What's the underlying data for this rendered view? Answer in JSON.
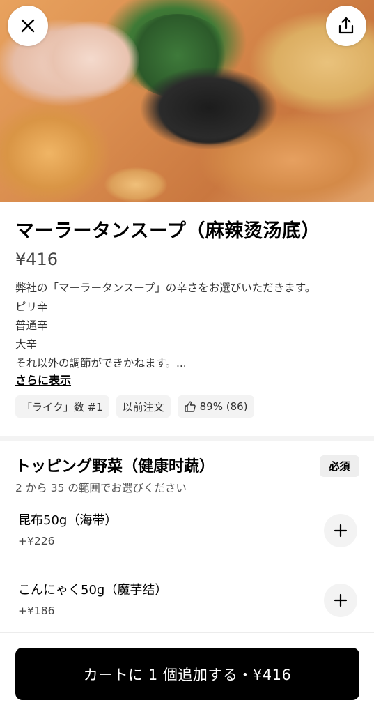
{
  "header": {
    "close_icon": "close-icon",
    "share_icon": "share-icon"
  },
  "item": {
    "title": "マーラータンスープ（麻辣烫汤底）",
    "price": "¥416",
    "description": [
      "弊社の「マーラータンスープ」の辛さをお選びいただきます。",
      "ピリ辛",
      "普通辛",
      "大辛",
      "それ以外の調節ができかねます。..."
    ],
    "show_more": "さらに表示",
    "badges": {
      "likes_rank": "「ライク」数 #1",
      "ordered_before": "以前注文",
      "rating": "89% (86)"
    }
  },
  "options_section": {
    "title": "トッピング野菜（健康时蔬）",
    "required_label": "必須",
    "subtitle": "2 から 35 の範囲でお選びください",
    "options": [
      {
        "name": "昆布50g（海带）",
        "price": "+¥226"
      },
      {
        "name": "こんにゃく50g（魔芋结）",
        "price": "+¥186"
      }
    ]
  },
  "cart": {
    "button_label": "カートに 1 個追加する・¥416"
  }
}
